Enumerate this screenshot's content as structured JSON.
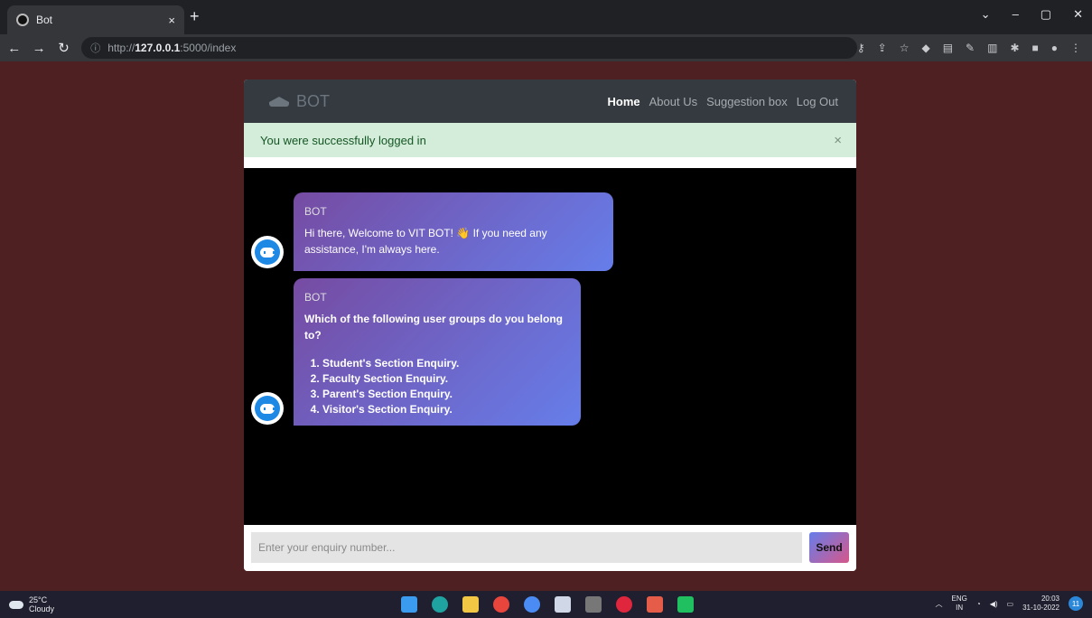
{
  "browser": {
    "tab_title": "Bot",
    "tab_close": "×",
    "new_tab": "+",
    "url_prefix": "http://",
    "url_host": "127.0.0.1",
    "url_rest": ":5000/index"
  },
  "navbar": {
    "brand": "BOT",
    "items": [
      "Home",
      "About Us",
      "Suggestion box",
      "Log Out"
    ],
    "active": "Home"
  },
  "alert": {
    "message": "You were successfully logged in",
    "close": "×"
  },
  "messages": [
    {
      "sender": "BOT",
      "text_before": "Hi there, Welcome to VIT BOT!",
      "emoji": "👋",
      "text_after": "If you need any assistance, I'm always here."
    },
    {
      "sender": "BOT",
      "question": "Which of the following user groups do you belong to?",
      "options": [
        "Student's Section Enquiry.",
        "Faculty Section Enquiry.",
        "Parent's Section Enquiry.",
        "Visitor's Section Enquiry."
      ]
    }
  ],
  "input": {
    "placeholder": "Enter your enquiry number...",
    "send_label": "Send"
  },
  "taskbar": {
    "temperature": "25°C",
    "weather": "Cloudy",
    "lang_top": "ENG",
    "lang_bottom": "IN",
    "time": "20:03",
    "date": "31-10-2022",
    "notifications": "11"
  },
  "colors": {
    "page_bg": "#4f2021",
    "navbar_bg": "#343a40",
    "alert_bg": "#d4edda",
    "bubble_start": "#764ba2",
    "bubble_end": "#667eea"
  }
}
